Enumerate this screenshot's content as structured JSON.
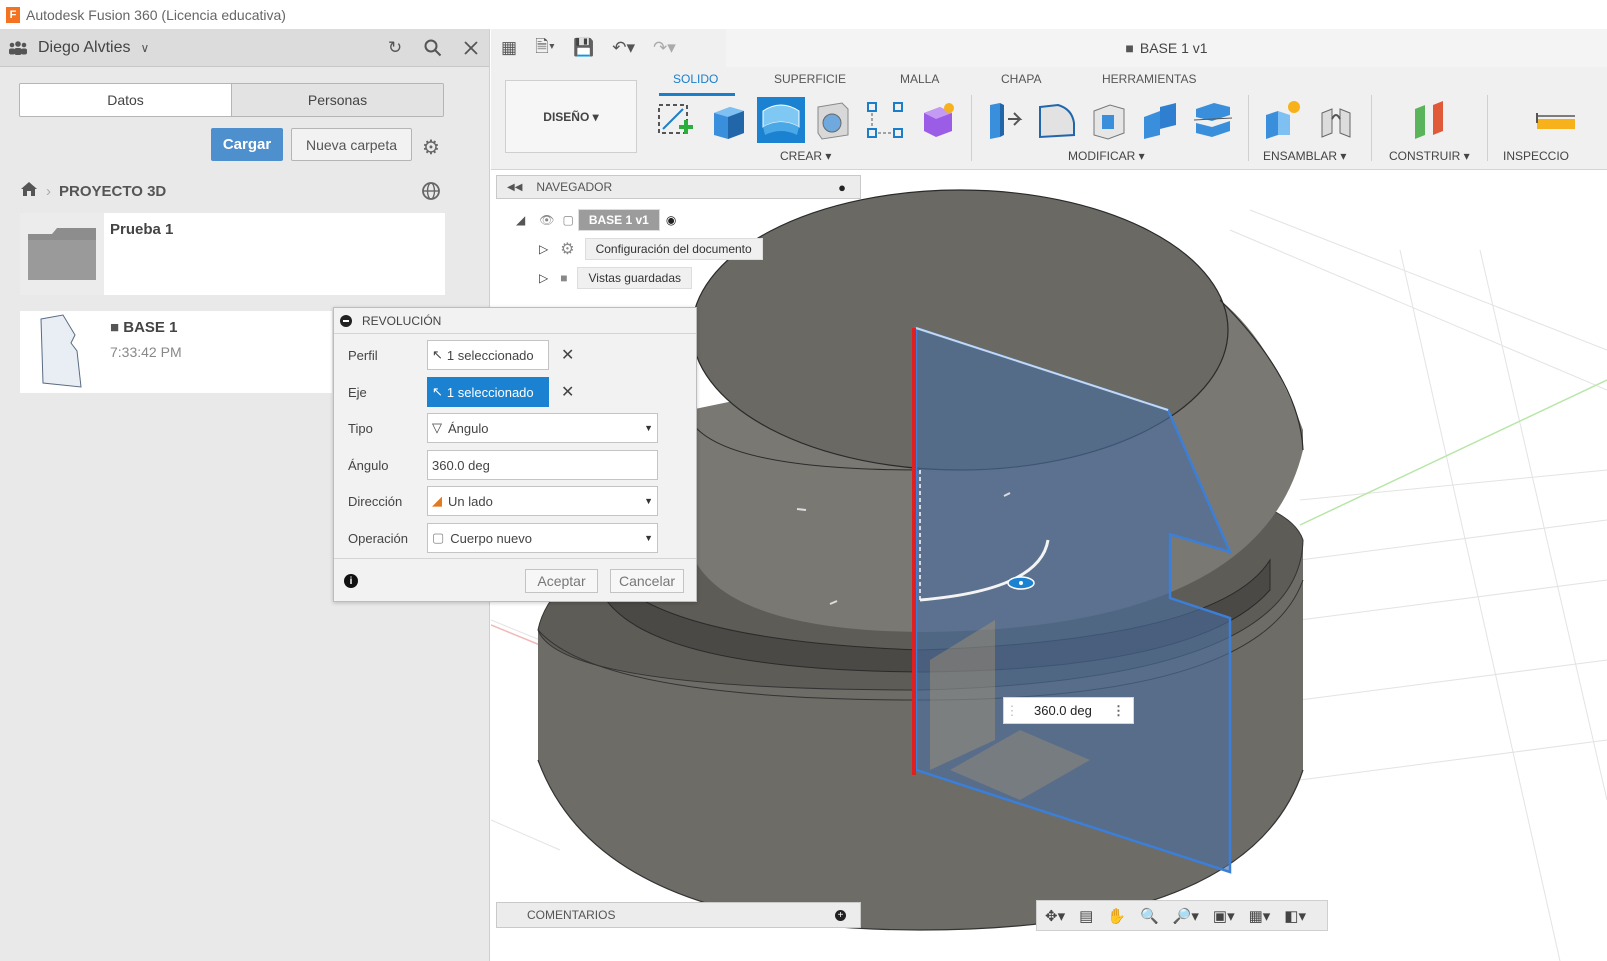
{
  "window": {
    "title": "Autodesk Fusion 360 (Licencia educativa)",
    "logo_letter": "F"
  },
  "data_panel": {
    "user_name": "Diego Alvties",
    "tabs": [
      "Datos",
      "Personas"
    ],
    "upload_label": "Cargar",
    "new_folder_label": "Nueva carpeta",
    "breadcrumb": "PROYECTO 3D",
    "items": [
      {
        "name": "Prueba 1",
        "time": ""
      },
      {
        "name": "BASE 1",
        "time": "7:33:42 PM"
      }
    ]
  },
  "toolbar": {
    "document_title": "BASE 1 v1",
    "design_label": "DISEÑO",
    "workspace_tabs": [
      "SOLIDO",
      "SUPERFICIE",
      "MALLA",
      "CHAPA",
      "HERRAMIENTAS"
    ],
    "active_tab": "SOLIDO",
    "groups": {
      "create": "CREAR",
      "modify": "MODIFICAR",
      "assemble": "ENSAMBLAR",
      "construct": "CONSTRUIR",
      "inspect": "INSPECCIO"
    }
  },
  "navigator": {
    "title": "NAVEGADOR",
    "root": "BASE 1 v1",
    "children": [
      "Configuración del documento",
      "Vistas guardadas"
    ]
  },
  "revolve_dialog": {
    "title": "REVOLUCIÓN",
    "fields": {
      "profile_label": "Perfil",
      "profile_value": "1 seleccionado",
      "axis_label": "Eje",
      "axis_value": "1 seleccionado",
      "type_label": "Tipo",
      "type_value": "Ángulo",
      "angle_label": "Ángulo",
      "angle_value": "360.0 deg",
      "direction_label": "Dirección",
      "direction_value": "Un lado",
      "operation_label": "Operación",
      "operation_value": "Cuerpo nuevo"
    },
    "ok_label": "Aceptar",
    "cancel_label": "Cancelar"
  },
  "viewport": {
    "angle_manipulator_value": "360.0 deg"
  },
  "comments": {
    "title": "COMENTARIOS"
  },
  "colors": {
    "accent": "#1a7ecb",
    "upload_button": "#4e8fce",
    "body_grey": "#7a7770",
    "profile_blue": "#4f6f96",
    "axis_red": "#e02020"
  }
}
